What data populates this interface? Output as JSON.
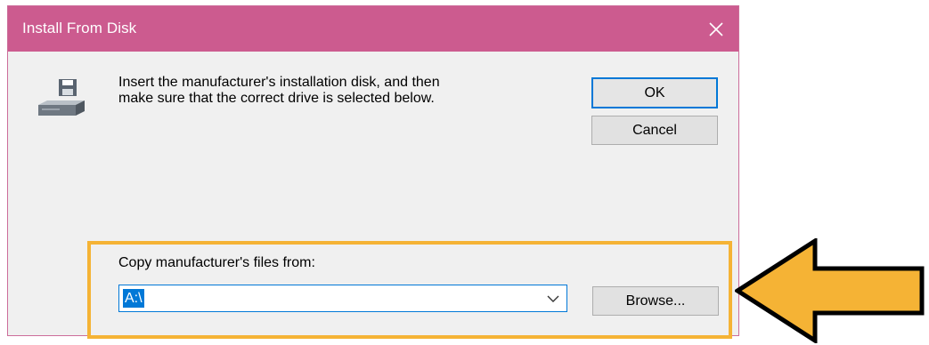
{
  "window": {
    "title": "Install From Disk",
    "close_icon": "close-icon",
    "title_color": "#cc5b8f"
  },
  "body": {
    "icon": "disk-drive-icon",
    "message_line1": "Insert the manufacturer's installation disk, and then",
    "message_line2": "make sure that the correct drive is selected below."
  },
  "buttons": {
    "ok_label": "OK",
    "cancel_label": "Cancel",
    "browse_label": "Browse..."
  },
  "copy_from": {
    "label": "Copy manufacturer's files from:",
    "value": "A:\\",
    "dropdown_icon": "chevron-down-icon"
  },
  "annotation": {
    "highlight_color": "#f5b335",
    "arrow_icon": "left-arrow-icon"
  }
}
